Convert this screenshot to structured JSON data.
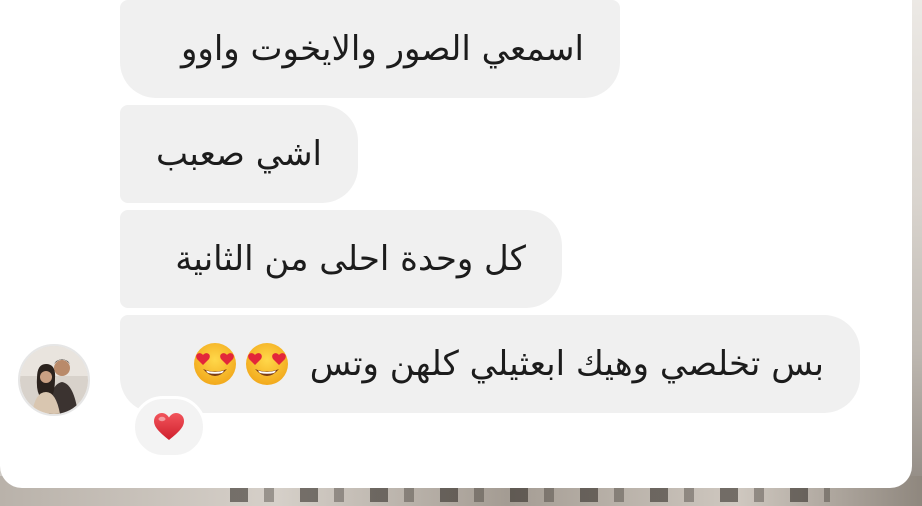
{
  "messages": [
    {
      "text": "اسمعي الصور والايخوت واوو"
    },
    {
      "text": "اشي صعبب"
    },
    {
      "text": "كل وحدة احلى من الثانية"
    },
    {
      "text": "بس تخلصي وهيك ابعثيلي كلهن وتس",
      "emojis": [
        "heart-eyes-emoji",
        "heart-eyes-emoji"
      ]
    }
  ],
  "reaction": {
    "icon": "red-heart-icon",
    "color": "#e0333c"
  },
  "colors": {
    "bubble": "#f0f0f0",
    "panel": "#ffffff",
    "text": "#1c1c1c"
  }
}
